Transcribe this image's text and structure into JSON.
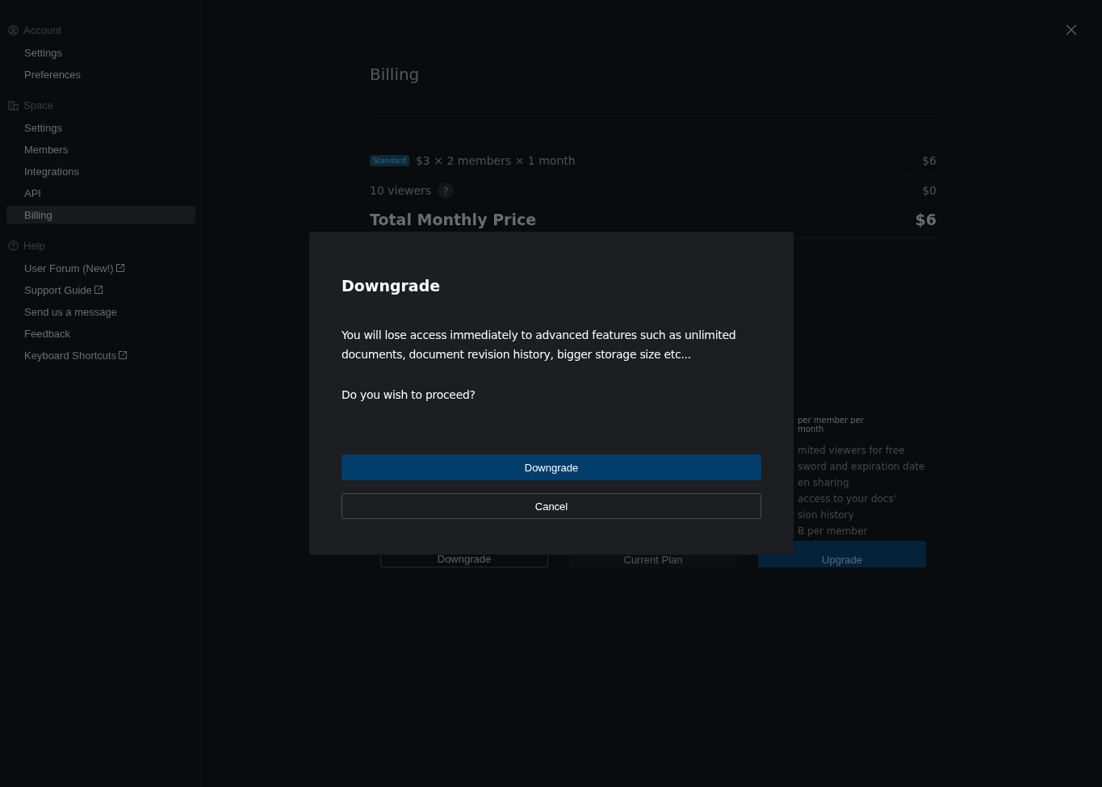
{
  "sidebar": {
    "sections": [
      {
        "title": "Account",
        "items": [
          {
            "label": "Settings",
            "selected": false,
            "external": false
          },
          {
            "label": "Preferences",
            "selected": false,
            "external": false
          }
        ]
      },
      {
        "title": "Space",
        "items": [
          {
            "label": "Settings",
            "selected": false,
            "external": false
          },
          {
            "label": "Members",
            "selected": false,
            "external": false
          },
          {
            "label": "Integrations",
            "selected": false,
            "external": false
          },
          {
            "label": "API",
            "selected": false,
            "external": false
          },
          {
            "label": "Billing",
            "selected": true,
            "external": false
          }
        ]
      },
      {
        "title": "Help",
        "items": [
          {
            "label": "User Forum (New!)",
            "selected": false,
            "external": true
          },
          {
            "label": "Support Guide",
            "selected": false,
            "external": true
          },
          {
            "label": "Send us a message",
            "selected": false,
            "external": false
          },
          {
            "label": "Feedback",
            "selected": false,
            "external": false
          },
          {
            "label": "Keyboard Shortcuts",
            "selected": false,
            "external": true
          }
        ]
      }
    ]
  },
  "billing": {
    "title": "Billing",
    "lines": [
      {
        "badge": "Standard",
        "label": "$3 × 2 members × 1 month",
        "amount": "$6",
        "help": false
      },
      {
        "label": "10 viewers",
        "amount": "$0",
        "help": true,
        "help_mark": "?"
      }
    ],
    "total": {
      "label": "Total Monthly Price",
      "amount": "$6"
    },
    "plans": [
      {
        "button": "Downgrade",
        "kind": "outline"
      },
      {
        "button": "Current Plan",
        "kind": "plain"
      },
      {
        "price_note": [
          "per member per",
          "month"
        ],
        "features": [
          "mited viewers for free",
          "sword and expiration date",
          "en sharing",
          "access to your docs'",
          "sion history",
          "B per member"
        ],
        "button": "Upgrade",
        "kind": "primary"
      }
    ]
  },
  "dialog": {
    "title": "Downgrade",
    "message": "You will lose access immediately to advanced features such as unlimited documents, document revision history, bigger storage size etc...",
    "question": "Do you wish to proceed?",
    "confirm": "Downgrade",
    "cancel": "Cancel"
  }
}
